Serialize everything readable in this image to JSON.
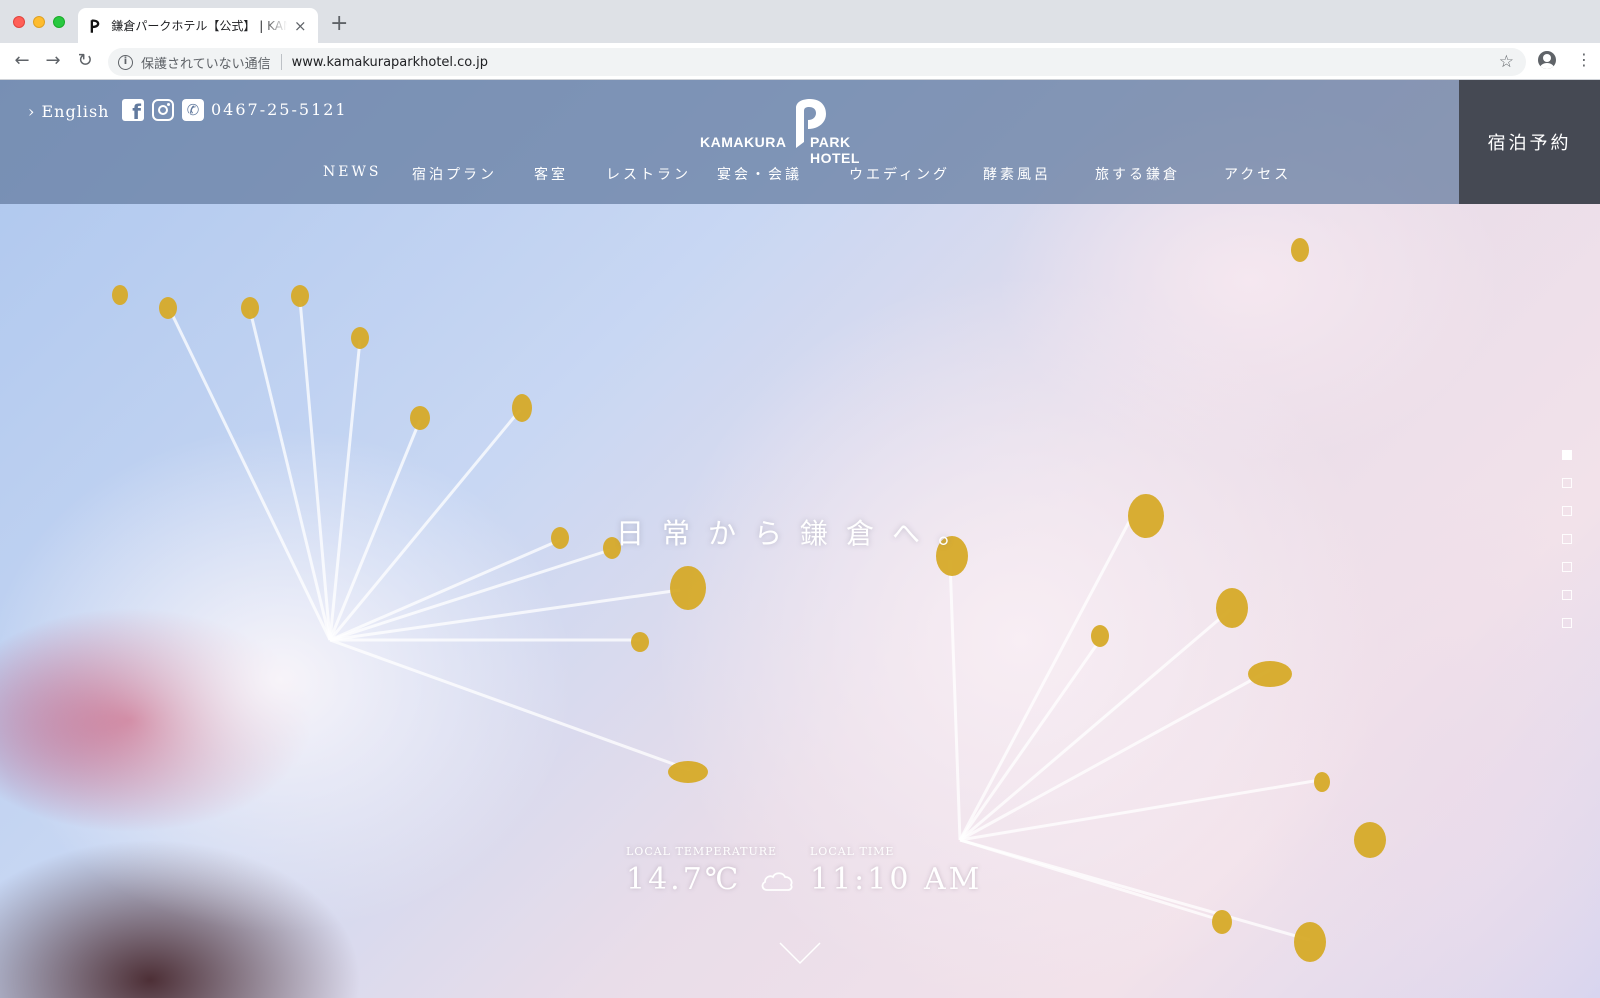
{
  "browser": {
    "tab_title": "鎌倉パークホテル【公式】 | KAMAKURA PARK HOTEL",
    "tab_close": "×",
    "new_tab": "+",
    "security_text": "保護されていない通信",
    "url": "www.kamakuraparkhotel.co.jp",
    "info_glyph": "i",
    "star_glyph": "☆",
    "menu_glyph": "⋮",
    "back_glyph": "←",
    "forward_glyph": "→",
    "reload_glyph": "↻"
  },
  "header": {
    "lang_link": "› English",
    "phone": "0467-25-5121",
    "phone_glyph": "✆",
    "fb_glyph": "f",
    "logo_left": "KAMAKURA",
    "logo_right": "PARK HOTEL",
    "reserve_label": "宿泊予約",
    "nav": [
      {
        "label": "NEWS"
      },
      {
        "label": "宿泊プラン"
      },
      {
        "label": "客室"
      },
      {
        "label": "レストラン"
      },
      {
        "label": "宴会・会議"
      },
      {
        "label": "ウエディング"
      },
      {
        "label": "酵素風呂"
      },
      {
        "label": "旅する鎌倉"
      },
      {
        "label": "アクセス"
      }
    ]
  },
  "hero": {
    "catchcopy": "日常から鎌倉へ。",
    "slides_total": 7,
    "slide_active": 1,
    "temperature_label": "LOCAL TEMPERATURE",
    "temperature_value": "14.7℃",
    "weather_icon": "cloud-icon",
    "time_label": "LOCAL TIME",
    "time_value": "11:10 AM"
  },
  "colors": {
    "header_overlay": "#627a9e",
    "reserve_bg": "#3e4048",
    "text": "#ffffff"
  }
}
